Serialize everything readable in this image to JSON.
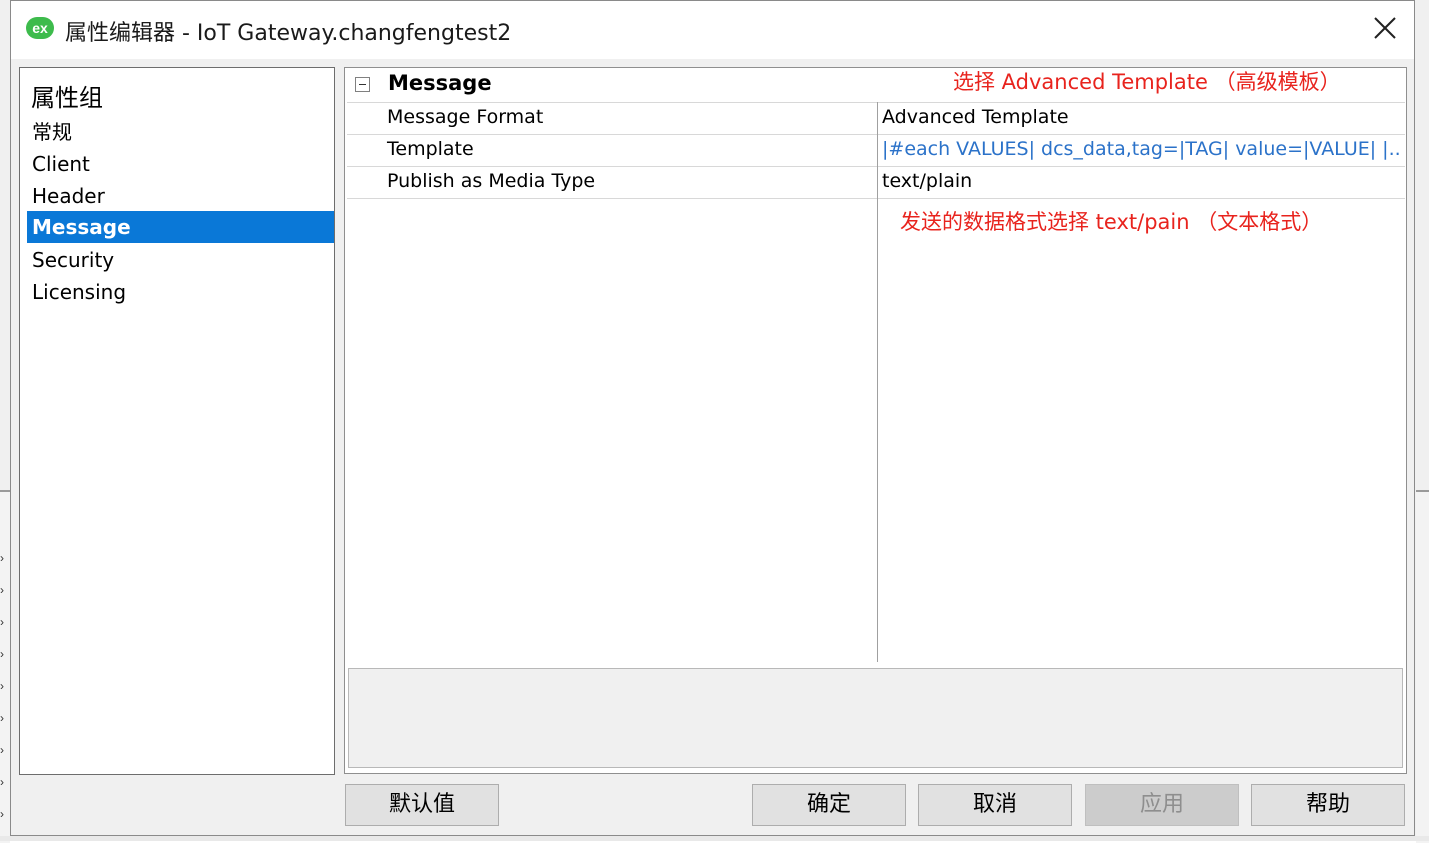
{
  "window": {
    "app_icon_text": "ex",
    "title": "属性编辑器 - IoT Gateway.changfengtest2"
  },
  "groups": {
    "header": "属性组",
    "items": [
      {
        "label": "常规",
        "selected": false
      },
      {
        "label": "Client",
        "selected": false
      },
      {
        "label": "Header",
        "selected": false
      },
      {
        "label": "Message",
        "selected": true
      },
      {
        "label": "Security",
        "selected": false
      },
      {
        "label": "Licensing",
        "selected": false
      }
    ]
  },
  "grid": {
    "category": "Message",
    "properties": [
      {
        "name": "Message Format",
        "value": "Advanced Template"
      },
      {
        "name": "Template",
        "value": "|#each VALUES|  dcs_data,tag=|TAG| value=|VALUE| |..."
      },
      {
        "name": "Publish as Media Type",
        "value": "text/plain"
      }
    ]
  },
  "annotations": {
    "format_note": "选择 Advanced Template （高级模板）",
    "media_note": "发送的数据格式选择 text/pain （文本格式）"
  },
  "buttons": {
    "default": "默认值",
    "ok": "确定",
    "cancel": "取消",
    "apply": "应用",
    "help": "帮助"
  },
  "colors": {
    "selection": "#0a78d7",
    "annotation": "#e8231d",
    "link_value": "#2b72c9",
    "app_icon": "#3dbb4c"
  }
}
